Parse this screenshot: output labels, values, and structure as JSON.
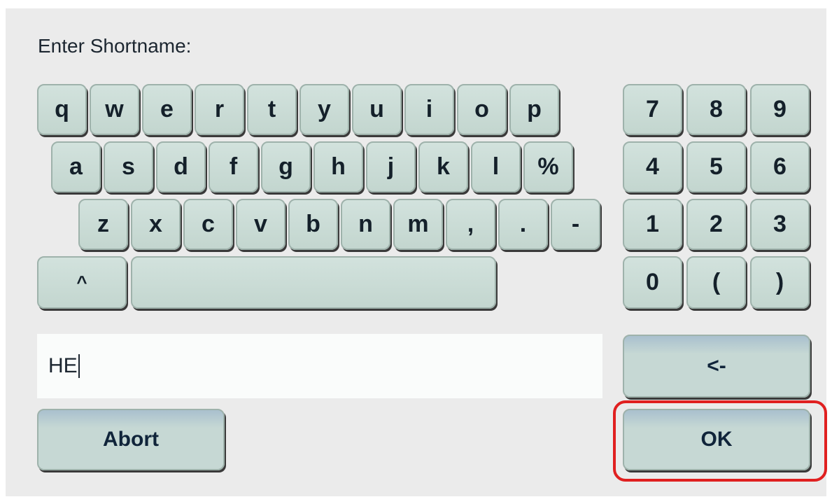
{
  "prompt_label": "Enter Shortname:",
  "keyboard": {
    "row1": [
      "q",
      "w",
      "e",
      "r",
      "t",
      "y",
      "u",
      "i",
      "o",
      "p"
    ],
    "row2": [
      "a",
      "s",
      "d",
      "f",
      "g",
      "h",
      "j",
      "k",
      "l",
      "%"
    ],
    "row3": [
      "z",
      "x",
      "c",
      "v",
      "b",
      "n",
      "m",
      ",",
      ".",
      "-"
    ],
    "shift_label": "^",
    "space_label": ""
  },
  "numpad": {
    "row1": [
      "7",
      "8",
      "9"
    ],
    "row2": [
      "4",
      "5",
      "6"
    ],
    "row3": [
      "1",
      "2",
      "3"
    ],
    "row4": [
      "0",
      "(",
      ")"
    ]
  },
  "input": {
    "value": "HE"
  },
  "buttons": {
    "backspace_label": "<-",
    "abort_label": "Abort",
    "ok_label": "OK"
  },
  "highlight_color": "#e02020"
}
